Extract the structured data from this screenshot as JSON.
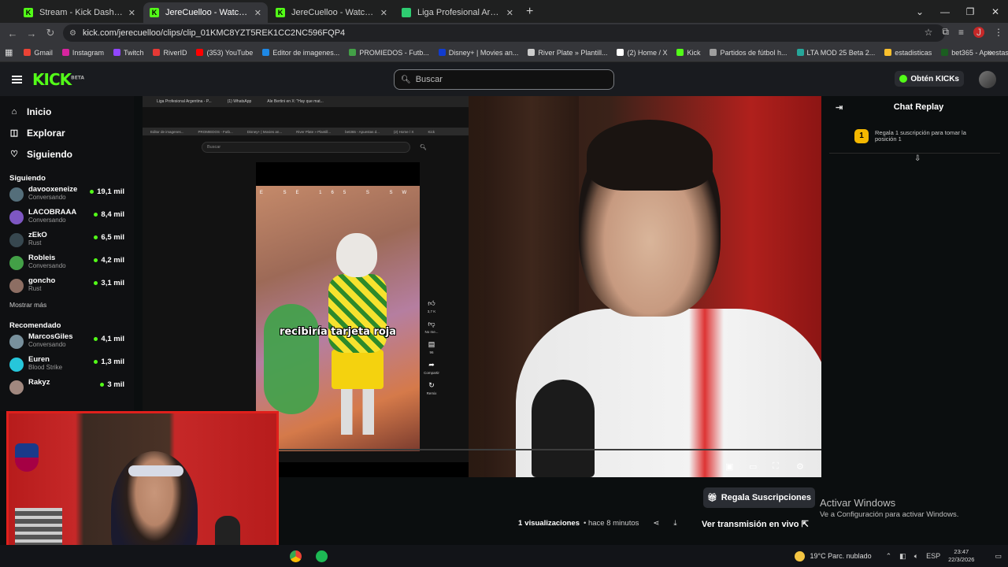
{
  "browser": {
    "tabs": [
      {
        "title": "Stream - Kick Dashboard",
        "favicon_color": "#53fc18",
        "favicon_letter": "K",
        "active": false
      },
      {
        "title": "JereCuelloo - Watch clips on Kick",
        "favicon_color": "#53fc18",
        "favicon_letter": "K",
        "active": true
      },
      {
        "title": "JereCuelloo - Watch clips on Kick",
        "favicon_color": "#53fc18",
        "favicon_letter": "K",
        "active": false
      },
      {
        "title": "Liga Profesional Argentina - PC",
        "favicon_color": "#2ecc71",
        "favicon_letter": "",
        "active": false
      }
    ],
    "url": "kick.com/jerecuelloo/clips/clip_01KMC8YZT5REK1CC2NC596FQP4",
    "bookmarks": [
      {
        "label": "Gmail",
        "color": "#ea4335"
      },
      {
        "label": "Instagram",
        "color": "#d6249f"
      },
      {
        "label": "Twitch",
        "color": "#9146ff"
      },
      {
        "label": "RiverID",
        "color": "#e53935"
      },
      {
        "label": "(353) YouTube",
        "color": "#ff0000"
      },
      {
        "label": "Editor de imagenes...",
        "color": "#1e88e5"
      },
      {
        "label": "PROMIEDOS - Futb...",
        "color": "#43a047"
      },
      {
        "label": "Disney+ | Movies an...",
        "color": "#113ccf"
      },
      {
        "label": "River Plate » Plantill...",
        "color": "#cccccc"
      },
      {
        "label": "(2) Home / X",
        "color": "#ffffff"
      },
      {
        "label": "Kick",
        "color": "#53fc18"
      },
      {
        "label": "Partidos de fútbol h...",
        "color": "#9e9e9e"
      },
      {
        "label": "LTA MOD 25 Beta 2...",
        "color": "#26a69a"
      },
      {
        "label": "estadisticas",
        "color": "#fbc02d"
      },
      {
        "label": "bet365 - Apuestas d...",
        "color": "#1b5e20"
      }
    ],
    "profile_letter": "J"
  },
  "kick": {
    "logo": "KICK",
    "logo_sup": "BETA",
    "search_placeholder": "Buscar",
    "get_kicks": "Obtén KICKs",
    "nav": [
      {
        "label": "Inicio",
        "icon": "home-icon",
        "glyph": "⌂"
      },
      {
        "label": "Explorar",
        "icon": "compass-icon",
        "glyph": "◫"
      },
      {
        "label": "Siguiendo",
        "icon": "heart-icon",
        "glyph": "♡"
      }
    ],
    "following_title": "Siguiendo",
    "following": [
      {
        "name": "davooxeneize",
        "sub": "Conversando",
        "viewers": "19,1 mil",
        "color": "#546e7a"
      },
      {
        "name": "LACOBRAAA",
        "sub": "Conversando",
        "viewers": "8,4 mil",
        "color": "#7e57c2"
      },
      {
        "name": "zEkO",
        "sub": "Rust",
        "viewers": "6,5 mil",
        "color": "#37474f"
      },
      {
        "name": "Robleis",
        "sub": "Conversando",
        "viewers": "4,2 mil",
        "color": "#43a047"
      },
      {
        "name": "goncho",
        "sub": "Rust",
        "viewers": "3,1 mil",
        "color": "#8d6e63"
      }
    ],
    "show_more": "Mostrar más",
    "recommended_title": "Recomendado",
    "recommended": [
      {
        "name": "MarcosGiles",
        "sub": "Conversando",
        "viewers": "4,1 mil",
        "color": "#78909c"
      },
      {
        "name": "Euren",
        "sub": "Blood Strike",
        "viewers": "1,3 mil",
        "color": "#26c6da"
      },
      {
        "name": "Rakyz",
        "sub": "",
        "viewers": "3 mil",
        "color": "#a1887f"
      }
    ],
    "chat_title": "Chat Replay",
    "gift_badge": "1",
    "gift_text": "Regala 1 suscripción para tomar la posición 1",
    "gift_button": "Regala Suscripciones",
    "views_count": "1",
    "views_label": "visualizaciones",
    "time_ago": "• hace 8 minutos",
    "watch_live": "Ver transmisión en vivo"
  },
  "inner_screen": {
    "tabs": [
      "Liga Profesional Argentina - P...",
      "(1) WhatsApp",
      "Ale Bertini en X: \"Hay que mat..."
    ],
    "bookmarks": [
      "Editor de imagenes...",
      "PROMIEDOS - Futb...",
      "Disney+ | Movies an...",
      "River Plate » Plantill...",
      "bet365 - Apuestas d...",
      "(2) Home / X",
      "Kick"
    ],
    "search_placeholder": "Buscar",
    "caption": "recibiría tarjeta roja",
    "hud": "E SE 165 S SW",
    "actions": [
      {
        "icon": "like-icon",
        "glyph": "👍︎",
        "label": "3,7 K"
      },
      {
        "icon": "dislike-icon",
        "glyph": "👎︎",
        "label": "No me..."
      },
      {
        "icon": "comment-icon",
        "glyph": "▤",
        "label": "96"
      },
      {
        "icon": "share-icon",
        "glyph": "➦",
        "label": "Compartir"
      },
      {
        "icon": "remix-icon",
        "glyph": "↻",
        "label": "Remix"
      }
    ]
  },
  "windows": {
    "activate_title": "Activar Windows",
    "activate_sub": "Ve a Configuración para activar Windows.",
    "weather": "19°C  Parc. nublado",
    "lang": "ESP",
    "time": "23:47",
    "date": "22/3/2026"
  }
}
